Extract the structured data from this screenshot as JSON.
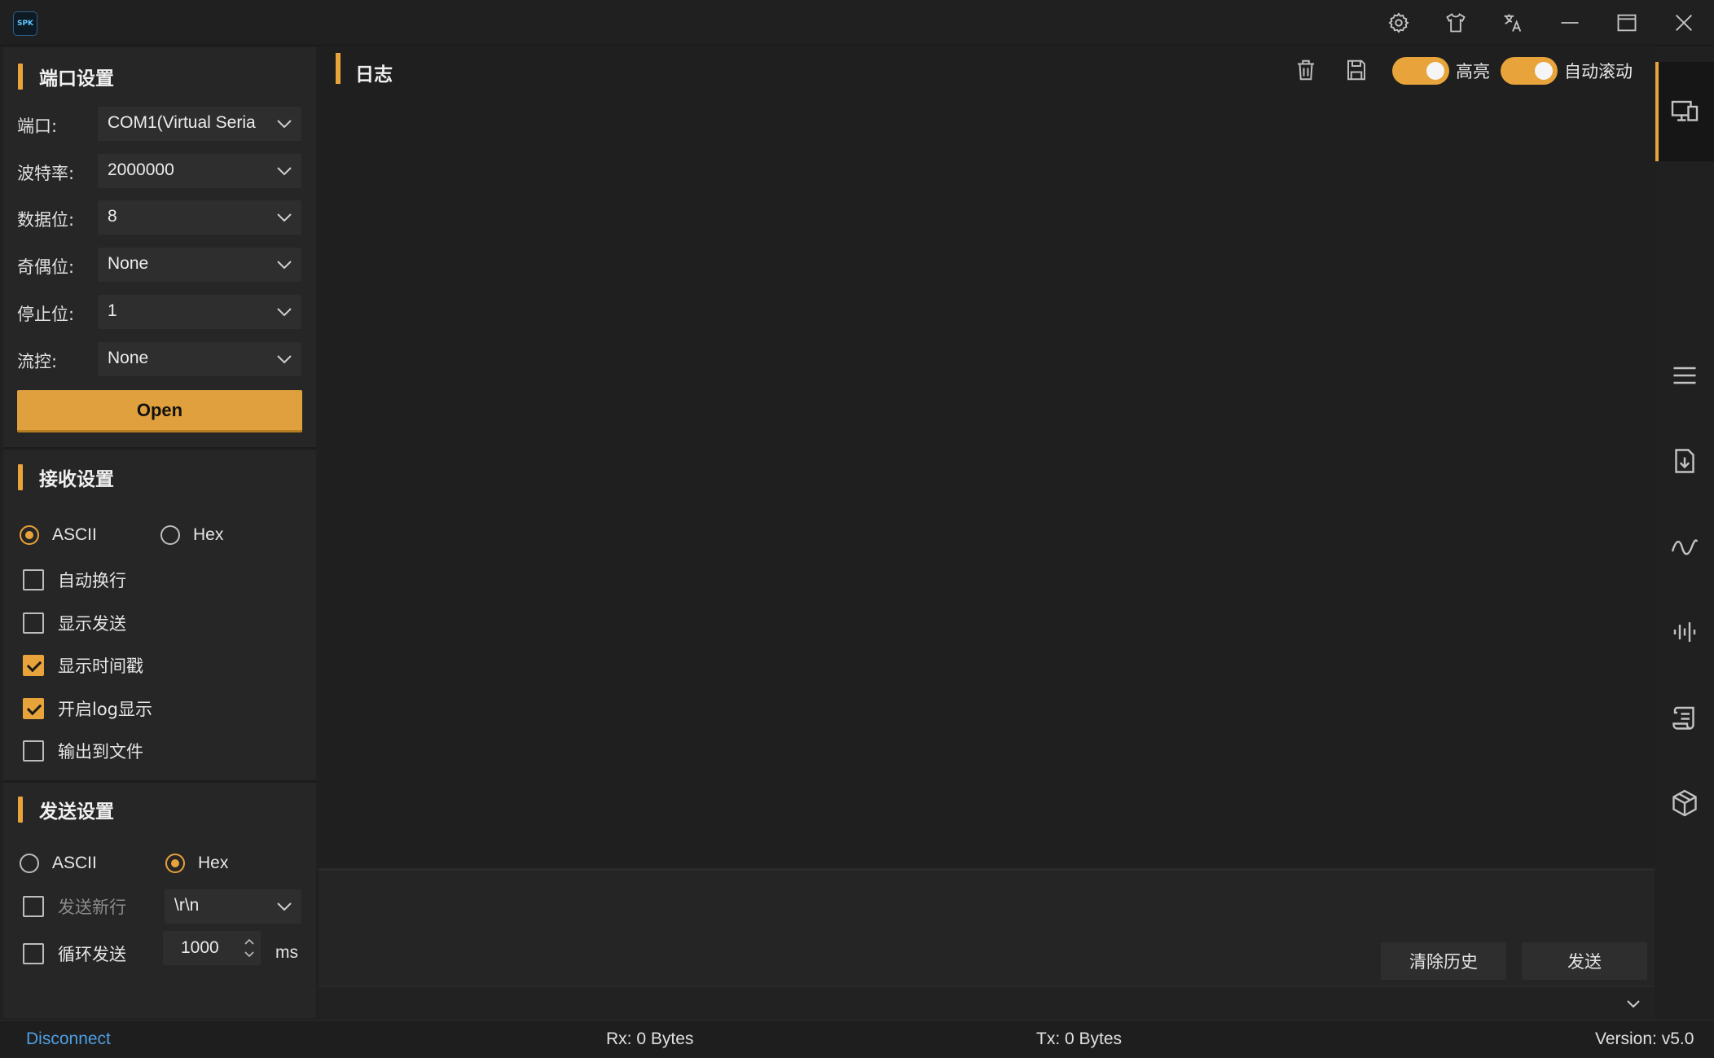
{
  "app": {
    "logo_text": "SPK"
  },
  "port_settings": {
    "title": "端口设置",
    "fields": [
      {
        "label": "端口:",
        "value": "COM1(Virtual Seria"
      },
      {
        "label": "波特率:",
        "value": "2000000"
      },
      {
        "label": "数据位:",
        "value": "8"
      },
      {
        "label": "奇偶位:",
        "value": "None"
      },
      {
        "label": "停止位:",
        "value": "1"
      },
      {
        "label": "流控:",
        "value": "None"
      }
    ],
    "open_label": "Open"
  },
  "receive_settings": {
    "title": "接收设置",
    "mode_options": [
      {
        "label": "ASCII",
        "checked": true
      },
      {
        "label": "Hex",
        "checked": false
      }
    ],
    "options": [
      {
        "label": "自动换行",
        "checked": false
      },
      {
        "label": "显示发送",
        "checked": false
      },
      {
        "label": "显示时间戳",
        "checked": true
      },
      {
        "label": "开启log显示",
        "checked": true
      },
      {
        "label": "输出到文件",
        "checked": false
      }
    ]
  },
  "send_settings": {
    "title": "发送设置",
    "mode_options": [
      {
        "label": "ASCII",
        "checked": false
      },
      {
        "label": "Hex",
        "checked": true
      }
    ],
    "newline_label": "发送新行",
    "newline_value": "\\r\\n",
    "loop_label": "循环发送",
    "interval_value": "1000",
    "interval_unit": "ms"
  },
  "log": {
    "title": "日志",
    "highlight_label": "高亮",
    "highlight_on": true,
    "autoscroll_label": "自动滚动",
    "autoscroll_on": true
  },
  "send_area": {
    "clear_history_label": "清除历史",
    "send_label": "发送"
  },
  "status": {
    "connection": "Disconnect",
    "rx": "Rx: 0 Bytes",
    "tx": "Tx: 0 Bytes",
    "version": "Version: v5.0"
  },
  "colors": {
    "accent": "#e8a33a",
    "background": "#202020",
    "link": "#4f9fe3"
  }
}
